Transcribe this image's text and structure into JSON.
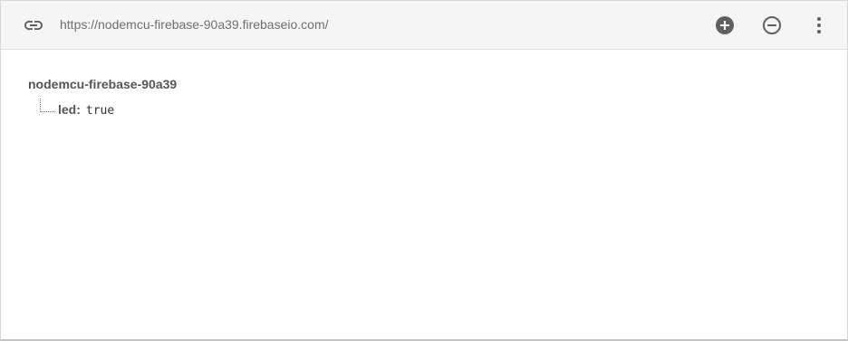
{
  "toolbar": {
    "database_url": "https://nodemcu-firebase-90a39.firebaseio.com/",
    "icons": {
      "link": "link-icon",
      "add": "add-circle-icon",
      "remove": "remove-circle-icon",
      "more": "more-vert-icon"
    }
  },
  "tree": {
    "root_name": "nodemcu-firebase-90a39",
    "children": [
      {
        "key": "led",
        "separator": ":",
        "value": "true"
      }
    ]
  },
  "colors": {
    "toolbar_bg": "#f5f5f5",
    "icon": "#5f5f5f",
    "text_key": "#555555"
  }
}
